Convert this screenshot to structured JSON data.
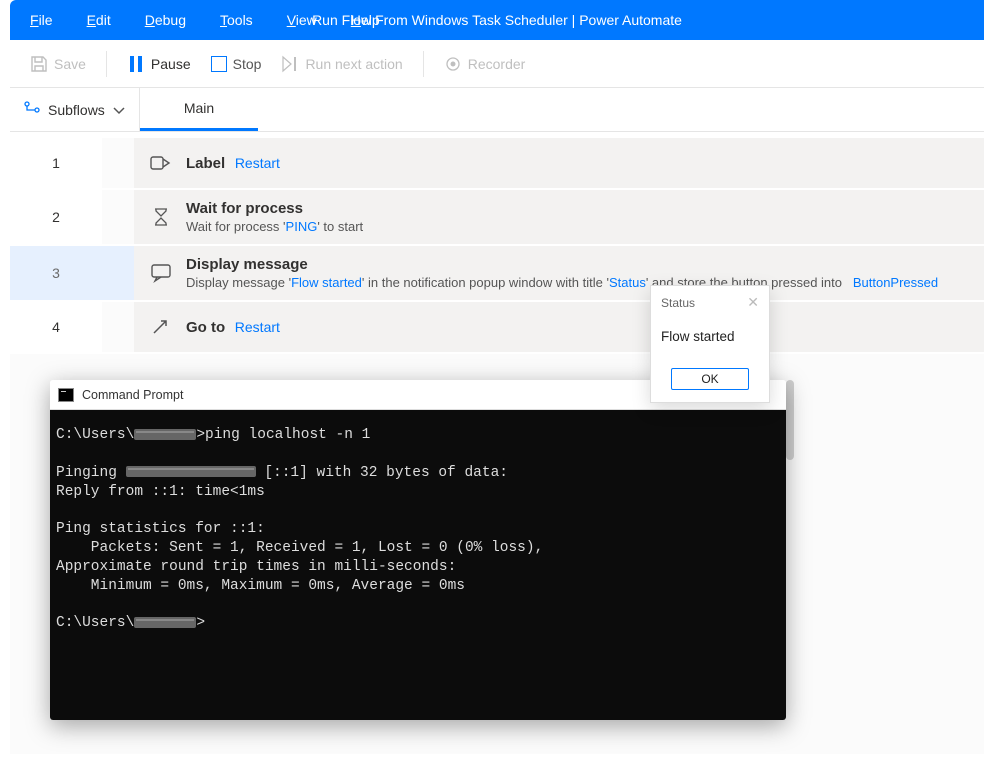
{
  "menubar": {
    "file": "File",
    "edit": "Edit",
    "debug": "Debug",
    "tools": "Tools",
    "view": "View",
    "help": "Help",
    "title": "Run Flow From Windows Task Scheduler | Power Automate"
  },
  "toolbar": {
    "save": "Save",
    "pause": "Pause",
    "stop": "Stop",
    "run_next": "Run next action",
    "recorder": "Recorder"
  },
  "subflows": {
    "label": "Subflows",
    "tabs": [
      {
        "label": "Main"
      }
    ]
  },
  "steps": [
    {
      "no": "1",
      "title": "Label",
      "inline_link": "Restart"
    },
    {
      "no": "2",
      "title": "Wait for process",
      "subtitle_pre": "Wait for process '",
      "subtitle_literal": "PING",
      "subtitle_post": "' to start"
    },
    {
      "no": "3",
      "title": "Display message",
      "subtitle_pre": "Display message '",
      "subtitle_lit1": "Flow started",
      "subtitle_mid": "' in the notification popup window with title '",
      "subtitle_lit2": "Status",
      "subtitle_post": "' and store the button pressed into ",
      "out_var": "ButtonPressed"
    },
    {
      "no": "4",
      "title": "Go to",
      "inline_link": "Restart"
    }
  ],
  "dialog": {
    "title": "Status",
    "message": "Flow started",
    "ok": "OK"
  },
  "cmd": {
    "title": "Command Prompt",
    "prompt_prefix": "C:\\Users\\",
    "line1_cmd": ">ping localhost -n 1",
    "line_pinging_pre": "Pinging ",
    "line_pinging_post": " [::1] with 32 bytes of data:",
    "line_reply": "Reply from ::1: time<1ms",
    "line_stats": "Ping statistics for ::1:",
    "line_packets": "    Packets: Sent = 1, Received = 1, Lost = 0 (0% loss),",
    "line_approx": "Approximate round trip times in milli-seconds:",
    "line_minmax": "    Minimum = 0ms, Maximum = 0ms, Average = 0ms",
    "prompt2_suffix": ">"
  }
}
